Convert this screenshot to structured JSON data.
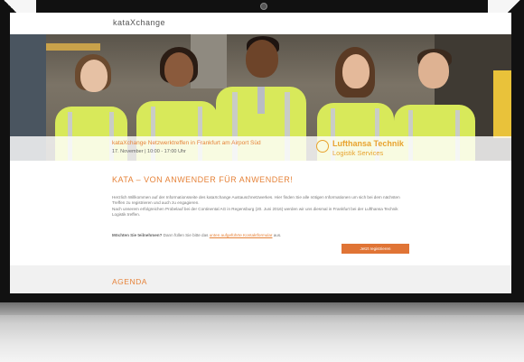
{
  "site": {
    "logo": "kataXchange"
  },
  "hero": {
    "event_title": "kataXchange Netzwerktreffen in Frankfurt am Airport Süd",
    "event_date": "17. November | 10:00 - 17:00 Uhr",
    "partner_name": "Lufthansa Technik",
    "partner_sub": "Logistik Services"
  },
  "content": {
    "headline": "KATA – VON ANWENDER FÜR ANWENDER!",
    "paragraph1": "Herzlich Willkommen auf der Informationsseite des kataXchange Austauschnetzwerkes. Hier finden Sie alle nötigen Informationen um sich bei dem nächsten Treffen zu registrieren und auch zu engagieren.",
    "paragraph2": "Nach unserem erfolgreichen Probelauf bei der Continental AG in Regensburg (20. Juni 2016) werden wir uns diesmal in Frankfurt bei der Lufthansa Technik Logistik treffen.",
    "cta_question": "Möchten Sie teilnehmen?",
    "cta_text": " Dann füllen Sie bitte das ",
    "cta_link": "unten aufgeführte Kontaktformular",
    "cta_end": " aus.",
    "register_label": "Jetzt registrieren"
  },
  "agenda": {
    "title": "AGENDA"
  }
}
